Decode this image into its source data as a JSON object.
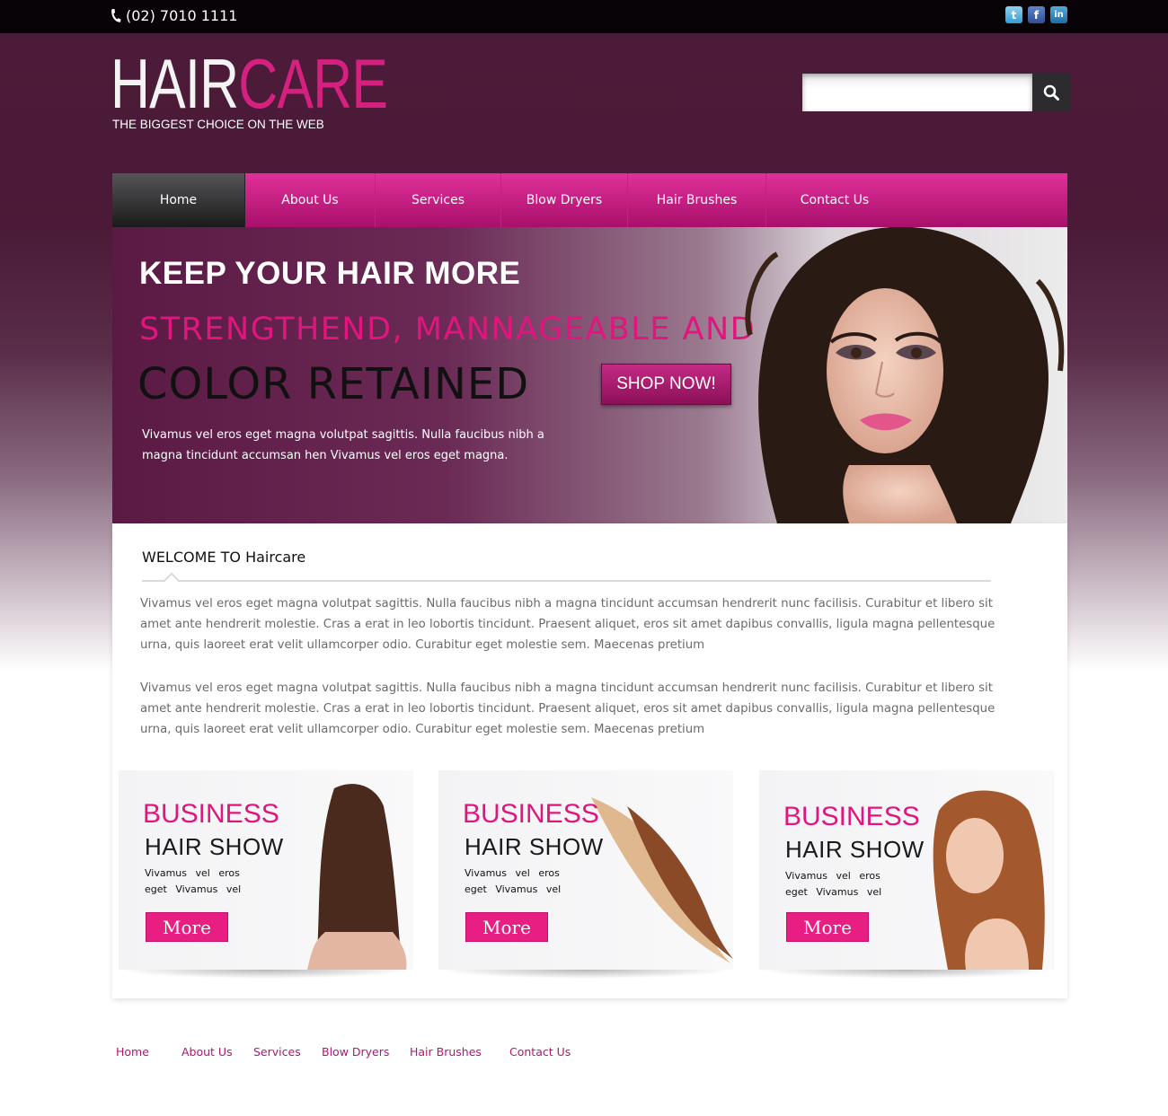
{
  "topbar": {
    "phone": "(02) 7010 1111",
    "social": [
      {
        "name": "twitter",
        "glyph": "t"
      },
      {
        "name": "facebook",
        "glyph": "f"
      },
      {
        "name": "linkedin",
        "glyph": "in"
      }
    ]
  },
  "logo": {
    "word_a": "HAIR",
    "word_b": "CARE",
    "tagline": "THE BIGGEST CHOICE ON THE WEB"
  },
  "search": {
    "placeholder": "",
    "value": ""
  },
  "nav": {
    "items": [
      {
        "label": "Home",
        "active": true
      },
      {
        "label": "About Us"
      },
      {
        "label": "Services"
      },
      {
        "label": "Blow Dryers"
      },
      {
        "label": "Hair Brushes"
      },
      {
        "label": "Contact Us"
      }
    ]
  },
  "hero": {
    "line1": "KEEP YOUR HAIR MORE",
    "line2": "STRENGTHEND, MANNAGEABLE AND",
    "line3": "COLOR RETAINED",
    "body": "Vivamus vel eros eget magna volutpat sagittis. Nulla faucibus nibh a magna tincidunt accumsan hen Vivamus vel eros eget magna.",
    "cta": "SHOP NOW!"
  },
  "welcome": {
    "title": "WELCOME TO Haircare",
    "para1": "Vivamus vel eros eget magna volutpat sagittis. Nulla faucibus nibh a magna tincidunt accumsan hendrerit nunc facilisis. Curabitur et libero sit amet ante hendrerit molestie. Cras a erat in leo lobortis tincidunt. Praesent aliquet, eros sit amet dapibus convallis, ligula magna pellentesque urna, quis laoreet erat velit ullamcorper odio. Curabitur eget molestie sem. Maecenas pretium",
    "para2": "Vivamus vel eros eget magna volutpat sagittis. Nulla faucibus nibh a magna tincidunt accumsan hendrerit nunc facilisis. Curabitur et libero sit amet ante hendrerit molestie. Cras a erat in leo lobortis tincidunt. Praesent aliquet, eros sit amet dapibus convallis, ligula magna pellentesque urna, quis laoreet erat velit ullamcorper odio. Curabitur eget molestie sem. Maecenas pretium"
  },
  "cards": [
    {
      "title": "BUSINESS",
      "subtitle": "HAIR SHOW",
      "text": "Vivamus vel eros eget Vivamus vel",
      "button": "More"
    },
    {
      "title": "BUSINESS",
      "subtitle": "HAIR SHOW",
      "text": "Vivamus vel eros eget Vivamus vel",
      "button": "More"
    },
    {
      "title": "BUSINESS",
      "subtitle": "HAIR SHOW",
      "text": "Vivamus vel eros eget Vivamus vel",
      "button": "More"
    }
  ],
  "footer": {
    "links": [
      "Home",
      "About Us",
      "Services",
      "Blow Dryers",
      "Hair Brushes",
      "Contact Us"
    ]
  },
  "colors": {
    "brand_pink": "#e0157d",
    "header_plum": "#4c1b39",
    "nav_dark": "#1b1b1c",
    "footer_link": "#b0166f"
  },
  "icons": [
    "phone-icon",
    "twitter-icon",
    "facebook-icon",
    "linkedin-icon",
    "search-icon"
  ]
}
